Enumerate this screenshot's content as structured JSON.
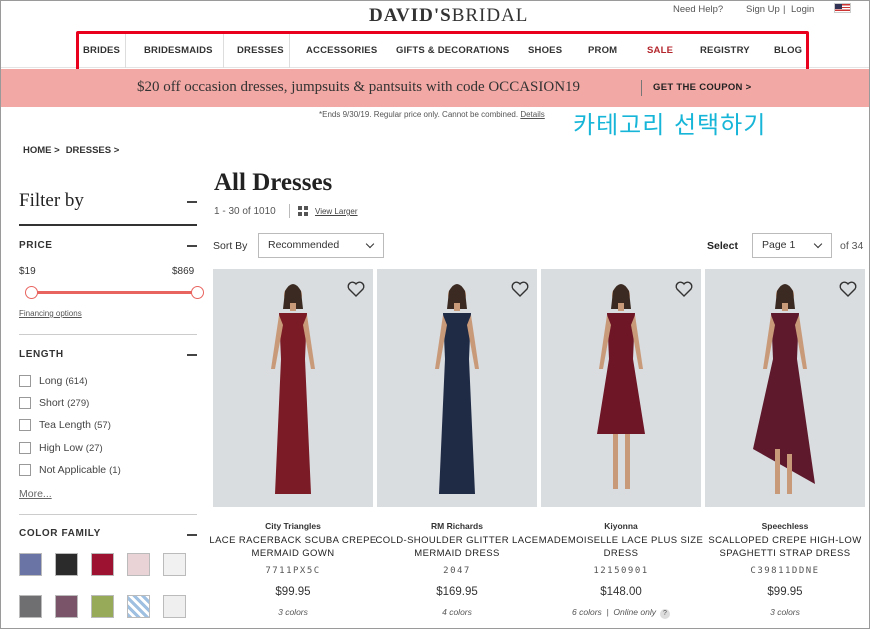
{
  "header": {
    "logo_main": "DAVID'S",
    "logo_sub": "BRIDAL",
    "help": "Need Help?",
    "sign_up": "Sign Up",
    "login": "Login",
    "divider": "|"
  },
  "nav": [
    "BRIDES",
    "BRIDESMAIDS",
    "DRESSES",
    "ACCESSORIES",
    "GIFTS & DECORATIONS",
    "SHOES",
    "PROM",
    "SALE",
    "REGISTRY",
    "BLOG"
  ],
  "promo": {
    "text": "$20 off occasion dresses, jumpsuits & pantsuits with code OCCASION19",
    "cta": "GET THE COUPON >",
    "fine_print": "*Ends 9/30/19. Regular price only. Cannot be combined.",
    "details": "Details"
  },
  "annotation": "카테고리 선택하기",
  "breadcrumb": [
    "HOME >",
    "DRESSES >"
  ],
  "filter": {
    "title": "Filter by",
    "price": {
      "title": "PRICE",
      "min": "$19",
      "max": "$869",
      "financing": "Financing options"
    },
    "length": {
      "title": "LENGTH",
      "options": [
        {
          "label": "Long",
          "count": "(614)"
        },
        {
          "label": "Short",
          "count": "(279)"
        },
        {
          "label": "Tea Length",
          "count": "(57)"
        },
        {
          "label": "High Low",
          "count": "(27)"
        },
        {
          "label": "Not Applicable",
          "count": "(1)"
        }
      ],
      "more": "More..."
    },
    "color_family": {
      "title": "COLOR FAMILY",
      "swatches": [
        "#6a75a6",
        "#2b2b2b",
        "#9c1230",
        "#ead3d7",
        "#f1f1f1",
        "#6f6f71",
        "#7a5468",
        "#96aa5a",
        "#b9cde0",
        "#efefef"
      ]
    }
  },
  "main": {
    "title": "All Dresses",
    "count": "1 - 30 of 1010",
    "view_larger": "View Larger",
    "sort_label": "Sort By",
    "sort_value": "Recommended",
    "select_label": "Select",
    "page_value": "Page 1",
    "page_of": "of 34"
  },
  "products": [
    {
      "brand": "City Triangles",
      "name": "LACE RACERBACK SCUBA CREPE MERMAID GOWN",
      "sku": "7711PX5C",
      "price": "$99.95",
      "colors": "3 colors",
      "online": "",
      "dress_color": "#7a1b25"
    },
    {
      "brand": "RM Richards",
      "name": "COLD-SHOULDER GLITTER LACE MERMAID DRESS",
      "sku": "2047",
      "price": "$169.95",
      "colors": "4 colors",
      "online": "",
      "dress_color": "#1f2a45"
    },
    {
      "brand": "Kiyonna",
      "name": "MADEMOISELLE LACE PLUS SIZE DRESS",
      "sku": "12150901",
      "price": "$148.00",
      "colors": "6 colors",
      "online": "Online only",
      "dress_color": "#6e1526"
    },
    {
      "brand": "Speechless",
      "name": "SCALLOPED CREPE HIGH-LOW SPAGHETTI STRAP DRESS",
      "sku": "C39811DDNE",
      "price": "$99.95",
      "colors": "3 colors",
      "online": "",
      "dress_color": "#5e1a2c"
    }
  ]
}
